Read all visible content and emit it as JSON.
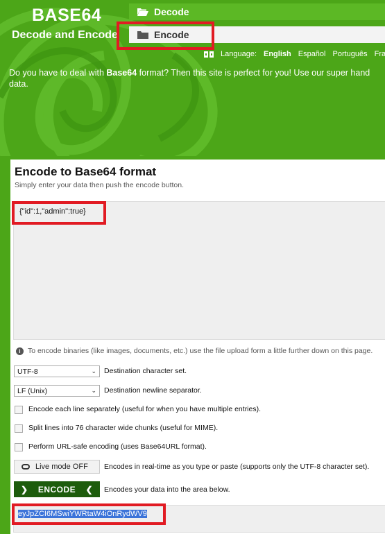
{
  "logo": {
    "title": "BASE64",
    "subtitle": "Decode and Encode"
  },
  "nav": {
    "decode": "Decode",
    "encode": "Encode"
  },
  "language": {
    "label": "Language:",
    "options": [
      "English",
      "Español",
      "Português",
      "Fra"
    ],
    "selected": "English"
  },
  "intro": {
    "before": "Do you have to deal with ",
    "bold": "Base64",
    "after": " format? Then this site is perfect for you! Use our super hand",
    "line2": "data."
  },
  "encode": {
    "title": "Encode to Base64 format",
    "subtitle": "Simply enter your data then push the encode button.",
    "input_value": "{\"id\":1,\"admin\":true}",
    "info": "To encode binaries (like images, documents, etc.) use the file upload form a little further down on this page.",
    "charset": {
      "value": "UTF-8",
      "label": "Destination character set."
    },
    "newline": {
      "value": "LF (Unix)",
      "label": "Destination newline separator."
    },
    "checks": [
      "Encode each line separately (useful for when you have multiple entries).",
      "Split lines into 76 character wide chunks (useful for MIME).",
      "Perform URL-safe encoding (uses Base64URL format)."
    ],
    "live": {
      "label": "Live mode OFF",
      "desc": "Encodes in real-time as you type or paste (supports only the UTF-8 character set)."
    },
    "button": {
      "label": "ENCODE",
      "desc": "Encodes your data into the area below."
    },
    "output_value": "eyJpZCI6MSwiYWRtaW4iOnRydWV9"
  }
}
